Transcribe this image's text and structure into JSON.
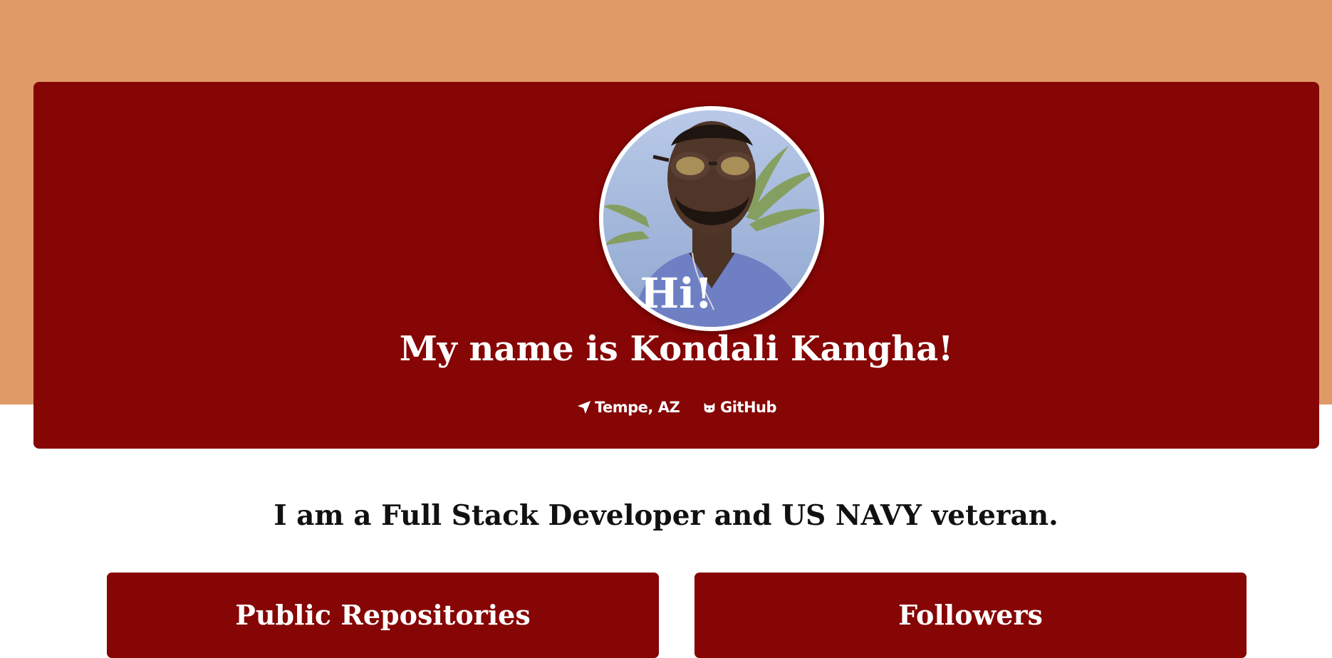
{
  "hero": {
    "greeting": "Hi!",
    "name_line": "My name is Kondali Kangha!",
    "links": [
      {
        "label": "Tempe, AZ",
        "icon": "location-arrow-icon"
      },
      {
        "label": "GitHub",
        "icon": "github-icon"
      }
    ]
  },
  "tagline": "I am a Full Stack Developer and US NAVY veteran.",
  "stats": [
    {
      "title": "Public Repositories"
    },
    {
      "title": "Followers"
    }
  ],
  "colors": {
    "band": "#e09a68",
    "card": "#860505",
    "text_light": "#ffffff",
    "text_dark": "#111111"
  }
}
